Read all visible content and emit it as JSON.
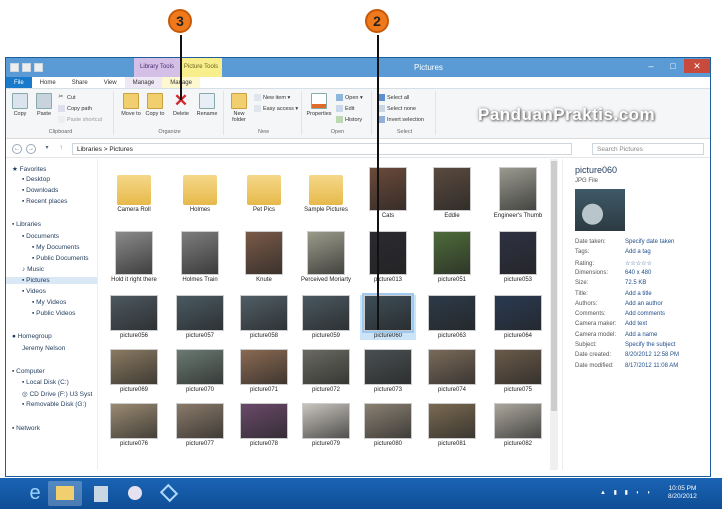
{
  "window": {
    "title": "Pictures",
    "contextual_tabs": [
      "Library Tools",
      "Picture Tools"
    ]
  },
  "tabs": [
    "File",
    "Home",
    "Share",
    "View",
    "Manage",
    "Manage"
  ],
  "ribbon": {
    "clipboard": {
      "label": "Clipboard",
      "copy": "Copy",
      "paste": "Paste",
      "cut": "Cut",
      "copy_path": "Copy path",
      "paste_shortcut": "Paste shortcut"
    },
    "organize": {
      "label": "Organize",
      "move_to": "Move to",
      "copy_to": "Copy to",
      "delete": "Delete",
      "rename": "Rename"
    },
    "new": {
      "label": "New",
      "new_folder": "New folder",
      "new_item": "New item",
      "easy_access": "Easy access"
    },
    "open": {
      "label": "Open",
      "properties": "Properties",
      "open": "Open",
      "edit": "Edit",
      "history": "History"
    },
    "select": {
      "label": "Select",
      "select_all": "Select all",
      "select_none": "Select none",
      "invert_selection": "Invert selection"
    }
  },
  "watermark": "PanduanPraktis.com",
  "address": {
    "path": "Libraries  >  Pictures",
    "search_placeholder": "Search Pictures"
  },
  "nav": {
    "favorites": "Favorites",
    "desktop": "Desktop",
    "downloads": "Downloads",
    "recent": "Recent places",
    "libraries": "Libraries",
    "documents": "Documents",
    "my_documents": "My Documents",
    "public_documents": "Public Documents",
    "music": "Music",
    "pictures": "Pictures",
    "videos": "Videos",
    "my_videos": "My Videos",
    "public_videos": "Public Videos",
    "homegroup": "Homegroup",
    "jeremy": "Jeremy Nelson",
    "computer": "Computer",
    "local_disk": "Local Disk (C:)",
    "cd_drive": "CD Drive (F:) U3 Syst",
    "removable": "Removable Disk (G:)",
    "network": "Network"
  },
  "items": [
    {
      "label": "Camera Roll",
      "kind": "folder"
    },
    {
      "label": "Holmes",
      "kind": "folder"
    },
    {
      "label": "Pet Pics",
      "kind": "folder"
    },
    {
      "label": "Sample Pictures",
      "kind": "folder"
    },
    {
      "label": "Cats",
      "kind": "photo",
      "color": "#6b4a3a"
    },
    {
      "label": "Eddie",
      "kind": "photo",
      "color": "#5a4a3e"
    },
    {
      "label": "Engineer's Thumb",
      "kind": "photo",
      "color": "#9a9a90"
    },
    {
      "label": "Hold it right there",
      "kind": "photo",
      "color": "#8a8a8a"
    },
    {
      "label": "Holmes Train",
      "kind": "photo",
      "color": "#7d7d7d"
    },
    {
      "label": "Knute",
      "kind": "photo",
      "color": "#7a5a48"
    },
    {
      "label": "Perceived Moriarty",
      "kind": "photo",
      "color": "#9a9a8a"
    },
    {
      "label": "picture013",
      "kind": "photo",
      "color": "#2a2a30"
    },
    {
      "label": "picture051",
      "kind": "photo",
      "color": "#4e6b3a"
    },
    {
      "label": "picture053",
      "kind": "photo",
      "color": "#2e3142"
    },
    {
      "label": "picture056",
      "kind": "photo",
      "color": "#4d5860"
    },
    {
      "label": "picture057",
      "kind": "photo",
      "color": "#4a5a62"
    },
    {
      "label": "picture058",
      "kind": "photo",
      "color": "#505e66"
    },
    {
      "label": "picture059",
      "kind": "photo",
      "color": "#4a5860"
    },
    {
      "label": "picture060",
      "kind": "photo",
      "color": "#3e4e58"
    },
    {
      "label": "picture063",
      "kind": "photo",
      "color": "#2c3a48"
    },
    {
      "label": "picture064",
      "kind": "photo",
      "color": "#2a3a52"
    },
    {
      "label": "picture069",
      "kind": "photo",
      "color": "#8a7a62"
    },
    {
      "label": "picture070",
      "kind": "photo",
      "color": "#6a7a72"
    },
    {
      "label": "picture071",
      "kind": "photo",
      "color": "#8a6a52"
    },
    {
      "label": "picture072",
      "kind": "photo",
      "color": "#6a6a62"
    },
    {
      "label": "picture073",
      "kind": "photo",
      "color": "#4a5052"
    },
    {
      "label": "picture074",
      "kind": "photo",
      "color": "#7a6a5a"
    },
    {
      "label": "picture075",
      "kind": "photo",
      "color": "#6a5a4a"
    },
    {
      "label": "picture076",
      "kind": "photo",
      "color": "#9a8a72"
    },
    {
      "label": "picture077",
      "kind": "photo",
      "color": "#8a7a6a"
    },
    {
      "label": "picture078",
      "kind": "photo",
      "color": "#6a4a6a"
    },
    {
      "label": "picture079",
      "kind": "photo",
      "color": "#c8c4be"
    },
    {
      "label": "picture080",
      "kind": "photo",
      "color": "#8a8072"
    },
    {
      "label": "picture081",
      "kind": "photo",
      "color": "#7a6a52"
    },
    {
      "label": "picture082",
      "kind": "photo",
      "color": "#aaa69c"
    }
  ],
  "selected_item": "picture060",
  "details": {
    "name": "picture060",
    "type": "JPG File",
    "props": [
      [
        "Date taken:",
        "Specify date taken"
      ],
      [
        "Tags:",
        "Add a tag"
      ],
      [
        "Rating:",
        "☆☆☆☆☆"
      ],
      [
        "Dimensions:",
        "640 x 480"
      ],
      [
        "Size:",
        "72.5 KB"
      ],
      [
        "Title:",
        "Add a title"
      ],
      [
        "Authors:",
        "Add an author"
      ],
      [
        "Comments:",
        "Add comments"
      ],
      [
        "Camera maker:",
        "Add text"
      ],
      [
        "Camera model:",
        "Add a name"
      ],
      [
        "Subject:",
        "Specify the subject"
      ],
      [
        "Date created:",
        "8/20/2012 12:58 PM"
      ],
      [
        "Date modified:",
        "8/17/2012 11:08 AM"
      ]
    ]
  },
  "taskbar": {
    "time": "10:05 PM",
    "date": "8/20/2012"
  },
  "callouts": [
    "3",
    "2"
  ],
  "colors": {
    "accent": "#1979ca",
    "selection": "#cce4f7",
    "callout": "#f07a1b"
  }
}
